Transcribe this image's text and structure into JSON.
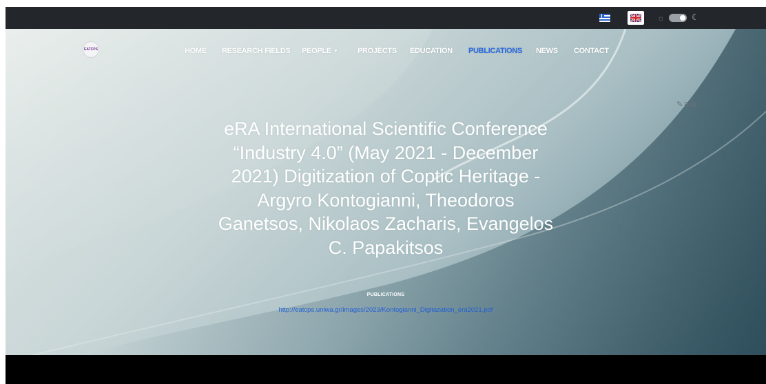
{
  "topbar": {
    "languages": [
      {
        "name": "greek-flag-icon",
        "code": "el"
      },
      {
        "name": "uk-flag-icon",
        "code": "en"
      }
    ],
    "theme": {
      "sun_icon": "sun-icon",
      "moon_icon": "moon-icon",
      "mode": "dark"
    }
  },
  "logo": {
    "text": "EATCPS LAB"
  },
  "nav": {
    "items": [
      {
        "label": "HOME"
      },
      {
        "label": "RESEARCH FIELDS"
      },
      {
        "label": "PEOPLE"
      },
      {
        "label": "PROJECTS"
      },
      {
        "label": "EDUCATION"
      },
      {
        "label": "PUBLICATIONS",
        "active": true
      },
      {
        "label": "NEWS"
      },
      {
        "label": "CONTACT"
      }
    ],
    "active_color": "#2a6be0"
  },
  "edit": {
    "label": "Edit"
  },
  "article": {
    "title_lines": [
      "eRA International Scientific Conference",
      "“Industry 4.0” (May 2021 - December",
      "2021) Digitization of Coptic Heritage -",
      "Argyro Kontogianni, Theodoros",
      "Ganetsos, Nikolaos Zacharis, Evangelos",
      "C. Papakitsos"
    ],
    "category": "PUBLICATIONS",
    "link": "http://eatcps.uniwa.gr/images/2023/Kontogianni_Digitazation_era2021.pdf"
  },
  "colors": {
    "topbar": "#23272b",
    "link": "#1f5fd6",
    "footer": "#000000"
  }
}
